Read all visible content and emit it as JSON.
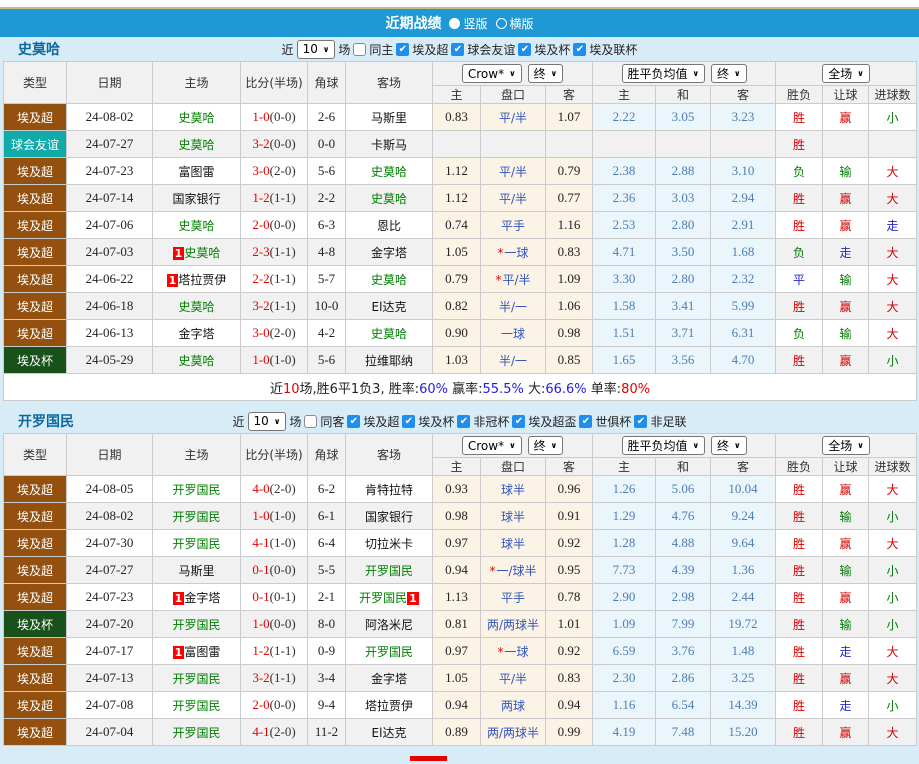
{
  "title_bar": {
    "title": "近期战绩",
    "radio_vertical": "竖版",
    "radio_horizontal": "横版"
  },
  "colors": {
    "header_bg": "#1F99D5",
    "page_bg": "#D8ECF8",
    "checkbox_blue": "#1E8FEF",
    "league": {
      "埃及超": "#93500F",
      "球会友谊": "#12A9A9",
      "埃及杯": "#19511B"
    }
  },
  "columns": {
    "type": "类型",
    "date": "日期",
    "home": "主场",
    "score": "比分(半场)",
    "corner": "角球",
    "away": "客场",
    "odds_home": "主",
    "handicap": "盘口",
    "odds_away": "客",
    "mean_home": "主",
    "mean_draw": "和",
    "mean_away": "客",
    "result_wdl": "胜负",
    "result_handicap": "让球",
    "result_goals": "进球数"
  },
  "controls": {
    "odds_source": "Crow*",
    "final1": "终",
    "mean_label": "胜平负均值",
    "final2": "终",
    "scope": "全场"
  },
  "sections": [
    {
      "team": "史莫哈",
      "filter": {
        "near": "近",
        "count": "10",
        "games": "场",
        "same": {
          "label": "同主",
          "checked": false
        },
        "leagues": [
          {
            "label": "埃及超",
            "checked": true
          },
          {
            "label": "球会友谊",
            "checked": true
          },
          {
            "label": "埃及杯",
            "checked": true
          },
          {
            "label": "埃及联杯",
            "checked": true
          }
        ]
      },
      "rows": [
        {
          "league": "埃及超",
          "date": "24-08-02",
          "home": {
            "name": "史莫哈",
            "green": true
          },
          "score": "1-0",
          "half": "(0-0)",
          "corner": "2-6",
          "away": {
            "name": "马斯里",
            "green": false
          },
          "odds": [
            "0.83",
            "平/半",
            "1.07"
          ],
          "star": false,
          "mean": [
            "2.22",
            "3.05",
            "3.23"
          ],
          "res": [
            [
              "胜",
              "r"
            ],
            [
              "赢",
              "r"
            ],
            [
              "小",
              "g"
            ]
          ]
        },
        {
          "league": "球会友谊",
          "date": "24-07-27",
          "home": {
            "name": "史莫哈",
            "green": true
          },
          "score": "3-2",
          "half": "(0-0)",
          "corner": "0-0",
          "away": {
            "name": "卡斯马",
            "green": false
          },
          "odds": [
            "",
            "",
            ""
          ],
          "star": false,
          "mean": [
            "",
            "",
            ""
          ],
          "res": [
            [
              "胜",
              "r"
            ],
            [
              "",
              ""
            ],
            [
              "",
              ""
            ]
          ]
        },
        {
          "league": "埃及超",
          "date": "24-07-23",
          "home": {
            "name": "富图雷",
            "green": false
          },
          "score": "3-0",
          "half": "(2-0)",
          "corner": "5-6",
          "away": {
            "name": "史莫哈",
            "green": true
          },
          "odds": [
            "1.12",
            "平/半",
            "0.79"
          ],
          "star": false,
          "mean": [
            "2.38",
            "2.88",
            "3.10"
          ],
          "res": [
            [
              "负",
              "g"
            ],
            [
              "输",
              "g"
            ],
            [
              "大",
              "r"
            ]
          ]
        },
        {
          "league": "埃及超",
          "date": "24-07-14",
          "home": {
            "name": "国家银行",
            "green": false
          },
          "score": "1-2",
          "half": "(1-1)",
          "corner": "2-2",
          "away": {
            "name": "史莫哈",
            "green": true
          },
          "odds": [
            "1.12",
            "平/半",
            "0.77"
          ],
          "star": false,
          "mean": [
            "2.36",
            "3.03",
            "2.94"
          ],
          "res": [
            [
              "胜",
              "r"
            ],
            [
              "赢",
              "r"
            ],
            [
              "大",
              "r"
            ]
          ]
        },
        {
          "league": "埃及超",
          "date": "24-07-06",
          "home": {
            "name": "史莫哈",
            "green": true
          },
          "score": "2-0",
          "half": "(0-0)",
          "corner": "6-3",
          "away": {
            "name": "恩比",
            "green": false
          },
          "odds": [
            "0.74",
            "平手",
            "1.16"
          ],
          "star": false,
          "mean": [
            "2.53",
            "2.80",
            "2.91"
          ],
          "res": [
            [
              "胜",
              "r"
            ],
            [
              "赢",
              "r"
            ],
            [
              "走",
              "b"
            ]
          ]
        },
        {
          "league": "埃及超",
          "date": "24-07-03",
          "home": {
            "name": "史莫哈",
            "green": true,
            "badge_before": "1"
          },
          "score": "2-3",
          "half": "(1-1)",
          "corner": "4-8",
          "away": {
            "name": "金字塔",
            "green": false
          },
          "odds": [
            "1.05",
            "一球",
            "0.83"
          ],
          "star": true,
          "mean": [
            "4.71",
            "3.50",
            "1.68"
          ],
          "res": [
            [
              "负",
              "g"
            ],
            [
              "走",
              "b"
            ],
            [
              "大",
              "r"
            ]
          ]
        },
        {
          "league": "埃及超",
          "date": "24-06-22",
          "home": {
            "name": "塔拉贾伊",
            "green": false,
            "badge_before": "1"
          },
          "score": "2-2",
          "half": "(1-1)",
          "corner": "5-7",
          "away": {
            "name": "史莫哈",
            "green": true
          },
          "odds": [
            "0.79",
            "平/半",
            "1.09"
          ],
          "star": true,
          "mean": [
            "3.30",
            "2.80",
            "2.32"
          ],
          "res": [
            [
              "平",
              "b"
            ],
            [
              "输",
              "g"
            ],
            [
              "大",
              "r"
            ]
          ]
        },
        {
          "league": "埃及超",
          "date": "24-06-18",
          "home": {
            "name": "史莫哈",
            "green": true
          },
          "score": "3-2",
          "half": "(1-1)",
          "corner": "10-0",
          "away": {
            "name": "El达克",
            "green": false
          },
          "odds": [
            "0.82",
            "半/一",
            "1.06"
          ],
          "star": false,
          "mean": [
            "1.58",
            "3.41",
            "5.99"
          ],
          "res": [
            [
              "胜",
              "r"
            ],
            [
              "赢",
              "r"
            ],
            [
              "大",
              "r"
            ]
          ]
        },
        {
          "league": "埃及超",
          "date": "24-06-13",
          "home": {
            "name": "金字塔",
            "green": false
          },
          "score": "3-0",
          "half": "(2-0)",
          "corner": "4-2",
          "away": {
            "name": "史莫哈",
            "green": true
          },
          "odds": [
            "0.90",
            "一球",
            "0.98"
          ],
          "star": false,
          "mean": [
            "1.51",
            "3.71",
            "6.31"
          ],
          "res": [
            [
              "负",
              "g"
            ],
            [
              "输",
              "g"
            ],
            [
              "大",
              "r"
            ]
          ]
        },
        {
          "league": "埃及杯",
          "date": "24-05-29",
          "home": {
            "name": "史莫哈",
            "green": true
          },
          "score": "1-0",
          "half": "(1-0)",
          "corner": "5-6",
          "away": {
            "name": "拉维耶纳",
            "green": false
          },
          "odds": [
            "1.03",
            "半/一",
            "0.85"
          ],
          "star": false,
          "mean": [
            "1.65",
            "3.56",
            "4.70"
          ],
          "res": [
            [
              "胜",
              "r"
            ],
            [
              "赢",
              "r"
            ],
            [
              "小",
              "g"
            ]
          ]
        }
      ],
      "summary": [
        [
          "近",
          "k"
        ],
        [
          "10",
          "r"
        ],
        [
          "场,胜6平1负3, 胜率:",
          "k"
        ],
        [
          "60%",
          "b"
        ],
        [
          " 赢率:",
          "k"
        ],
        [
          "55.5%",
          "b"
        ],
        [
          " 大:",
          "k"
        ],
        [
          "66.6%",
          "b"
        ],
        [
          " 单率:",
          "k"
        ],
        [
          "80%",
          "r"
        ]
      ]
    },
    {
      "team": "开罗国民",
      "filter": {
        "near": "近",
        "count": "10",
        "games": "场",
        "same": {
          "label": "同客",
          "checked": false
        },
        "leagues": [
          {
            "label": "埃及超",
            "checked": true
          },
          {
            "label": "埃及杯",
            "checked": true
          },
          {
            "label": "非冠杯",
            "checked": true
          },
          {
            "label": "埃及超盃",
            "checked": true
          },
          {
            "label": "世俱杯",
            "checked": true
          },
          {
            "label": "非足联",
            "checked": true
          }
        ]
      },
      "rows": [
        {
          "league": "埃及超",
          "date": "24-08-05",
          "home": {
            "name": "开罗国民",
            "green": true
          },
          "score": "4-0",
          "half": "(2-0)",
          "corner": "6-2",
          "away": {
            "name": "肯特拉特",
            "green": false
          },
          "odds": [
            "0.93",
            "球半",
            "0.96"
          ],
          "star": false,
          "mean": [
            "1.26",
            "5.06",
            "10.04"
          ],
          "res": [
            [
              "胜",
              "r"
            ],
            [
              "赢",
              "r"
            ],
            [
              "大",
              "r"
            ]
          ]
        },
        {
          "league": "埃及超",
          "date": "24-08-02",
          "home": {
            "name": "开罗国民",
            "green": true
          },
          "score": "1-0",
          "half": "(1-0)",
          "corner": "6-1",
          "away": {
            "name": "国家银行",
            "green": false
          },
          "odds": [
            "0.98",
            "球半",
            "0.91"
          ],
          "star": false,
          "mean": [
            "1.29",
            "4.76",
            "9.24"
          ],
          "res": [
            [
              "胜",
              "r"
            ],
            [
              "输",
              "g"
            ],
            [
              "小",
              "g"
            ]
          ]
        },
        {
          "league": "埃及超",
          "date": "24-07-30",
          "home": {
            "name": "开罗国民",
            "green": true
          },
          "score": "4-1",
          "half": "(1-0)",
          "corner": "6-4",
          "away": {
            "name": "切拉米卡",
            "green": false
          },
          "odds": [
            "0.97",
            "球半",
            "0.92"
          ],
          "star": false,
          "mean": [
            "1.28",
            "4.88",
            "9.64"
          ],
          "res": [
            [
              "胜",
              "r"
            ],
            [
              "赢",
              "r"
            ],
            [
              "大",
              "r"
            ]
          ]
        },
        {
          "league": "埃及超",
          "date": "24-07-27",
          "home": {
            "name": "马斯里",
            "green": false
          },
          "score": "0-1",
          "half": "(0-0)",
          "corner": "5-5",
          "away": {
            "name": "开罗国民",
            "green": true
          },
          "odds": [
            "0.94",
            "一/球半",
            "0.95"
          ],
          "star": true,
          "mean": [
            "7.73",
            "4.39",
            "1.36"
          ],
          "res": [
            [
              "胜",
              "r"
            ],
            [
              "输",
              "g"
            ],
            [
              "小",
              "g"
            ]
          ]
        },
        {
          "league": "埃及超",
          "date": "24-07-23",
          "home": {
            "name": "金字塔",
            "green": false,
            "badge_before": "1"
          },
          "score": "0-1",
          "half": "(0-1)",
          "corner": "2-1",
          "away": {
            "name": "开罗国民",
            "green": true,
            "badge_after": "1"
          },
          "odds": [
            "1.13",
            "平手",
            "0.78"
          ],
          "star": false,
          "mean": [
            "2.90",
            "2.98",
            "2.44"
          ],
          "res": [
            [
              "胜",
              "r"
            ],
            [
              "赢",
              "r"
            ],
            [
              "小",
              "g"
            ]
          ]
        },
        {
          "league": "埃及杯",
          "date": "24-07-20",
          "home": {
            "name": "开罗国民",
            "green": true
          },
          "score": "1-0",
          "half": "(0-0)",
          "corner": "8-0",
          "away": {
            "name": "阿洛米尼",
            "green": false
          },
          "odds": [
            "0.81",
            "两/两球半",
            "1.01"
          ],
          "star": false,
          "mean": [
            "1.09",
            "7.99",
            "19.72"
          ],
          "res": [
            [
              "胜",
              "r"
            ],
            [
              "输",
              "g"
            ],
            [
              "小",
              "g"
            ]
          ]
        },
        {
          "league": "埃及超",
          "date": "24-07-17",
          "home": {
            "name": "富图雷",
            "green": false,
            "badge_before": "1"
          },
          "score": "1-2",
          "half": "(1-1)",
          "corner": "0-9",
          "away": {
            "name": "开罗国民",
            "green": true
          },
          "odds": [
            "0.97",
            "一球",
            "0.92"
          ],
          "star": true,
          "mean": [
            "6.59",
            "3.76",
            "1.48"
          ],
          "res": [
            [
              "胜",
              "r"
            ],
            [
              "走",
              "b"
            ],
            [
              "大",
              "r"
            ]
          ]
        },
        {
          "league": "埃及超",
          "date": "24-07-13",
          "home": {
            "name": "开罗国民",
            "green": true
          },
          "score": "3-2",
          "half": "(1-1)",
          "corner": "3-4",
          "away": {
            "name": "金字塔",
            "green": false
          },
          "odds": [
            "1.05",
            "平/半",
            "0.83"
          ],
          "star": false,
          "mean": [
            "2.30",
            "2.86",
            "3.25"
          ],
          "res": [
            [
              "胜",
              "r"
            ],
            [
              "赢",
              "r"
            ],
            [
              "大",
              "r"
            ]
          ]
        },
        {
          "league": "埃及超",
          "date": "24-07-08",
          "home": {
            "name": "开罗国民",
            "green": true
          },
          "score": "2-0",
          "half": "(0-0)",
          "corner": "9-4",
          "away": {
            "name": "塔拉贾伊",
            "green": false
          },
          "odds": [
            "0.94",
            "两球",
            "0.94"
          ],
          "star": false,
          "mean": [
            "1.16",
            "6.54",
            "14.39"
          ],
          "res": [
            [
              "胜",
              "r"
            ],
            [
              "走",
              "b"
            ],
            [
              "小",
              "g"
            ]
          ]
        },
        {
          "league": "埃及超",
          "date": "24-07-04",
          "home": {
            "name": "开罗国民",
            "green": true
          },
          "score": "4-1",
          "half": "(2-0)",
          "corner": "11-2",
          "away": {
            "name": "El达克",
            "green": false
          },
          "odds": [
            "0.89",
            "两/两球半",
            "0.99"
          ],
          "star": false,
          "mean": [
            "4.19",
            "7.48",
            "15.20"
          ],
          "res": [
            [
              "胜",
              "r"
            ],
            [
              "赢",
              "r"
            ],
            [
              "大",
              "r"
            ]
          ]
        }
      ],
      "summary": null
    }
  ]
}
